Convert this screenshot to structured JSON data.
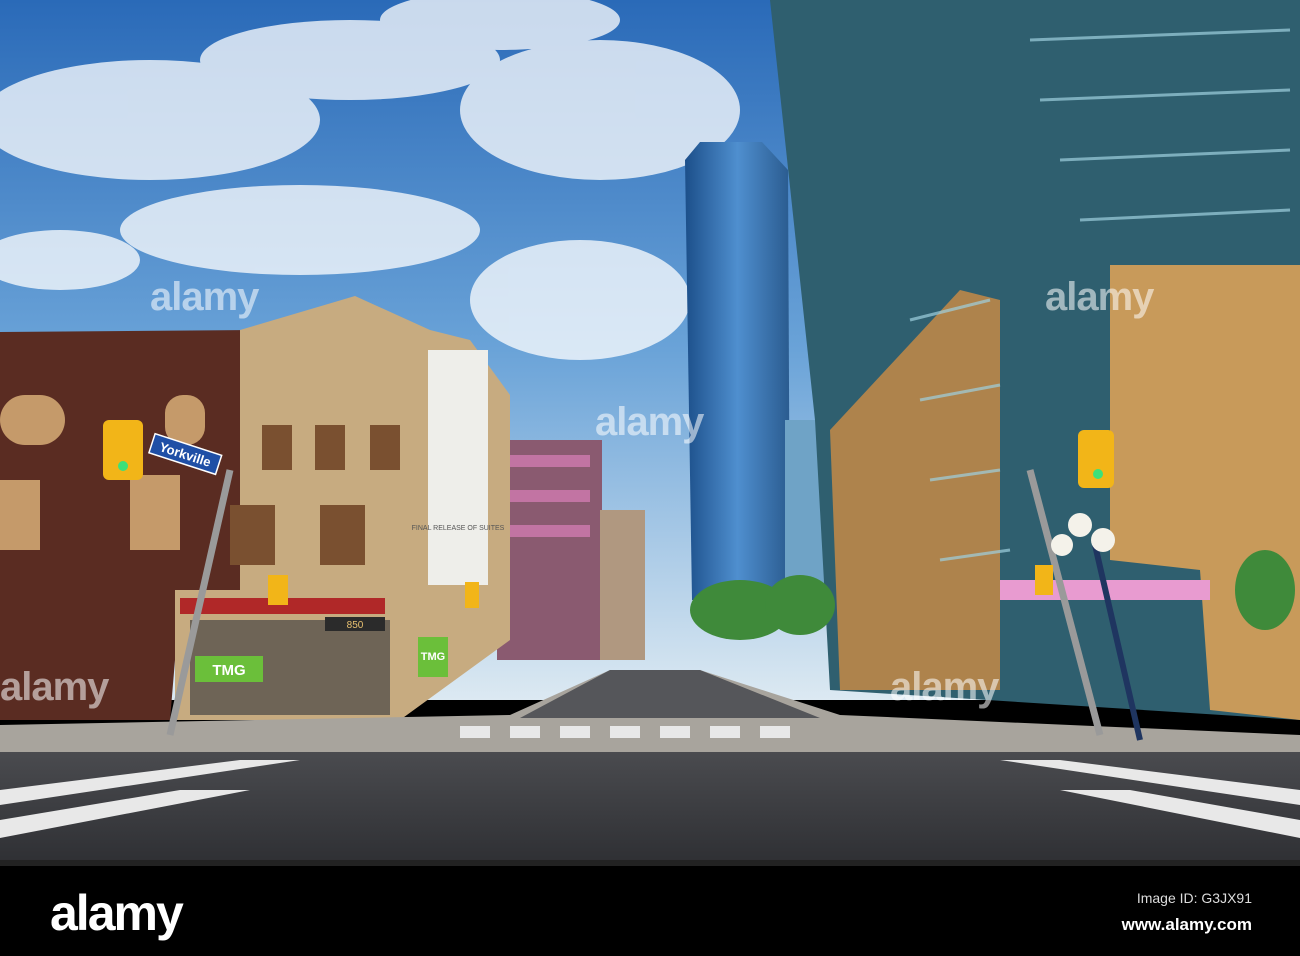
{
  "photo": {
    "street_sign": "Yorkville",
    "storefront_signs": [
      "TMG",
      "TMG",
      "850"
    ],
    "billboard_text": "FINAL RELEASE OF SUITES"
  },
  "watermark": {
    "text": "alamy"
  },
  "footer": {
    "logo": "alamy",
    "image_id": "Image ID: G3JX91",
    "website": "www.alamy.com"
  }
}
